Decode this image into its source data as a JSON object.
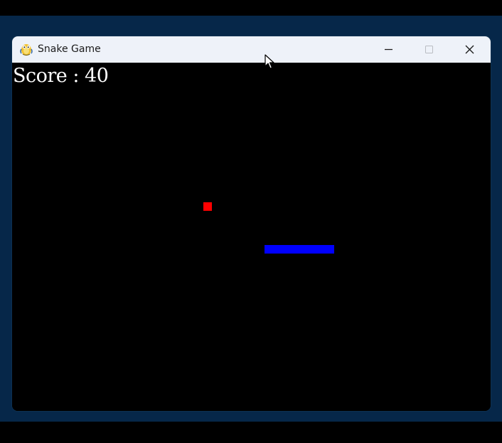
{
  "window": {
    "title": "Snake Game",
    "app_icon": "pygame-snake-icon",
    "controls": {
      "minimize_icon": "minimize-icon",
      "maximize_icon": "maximize-icon",
      "close_icon": "close-icon"
    }
  },
  "game": {
    "score_text": "Score : 40",
    "colors": {
      "background": "#000000",
      "food": "#ff0000",
      "snake": "#0000ff",
      "score_text": "#ffffff"
    }
  },
  "theme": {
    "desktop_background": "#062749",
    "titlebar_background": "#eef2f9"
  }
}
